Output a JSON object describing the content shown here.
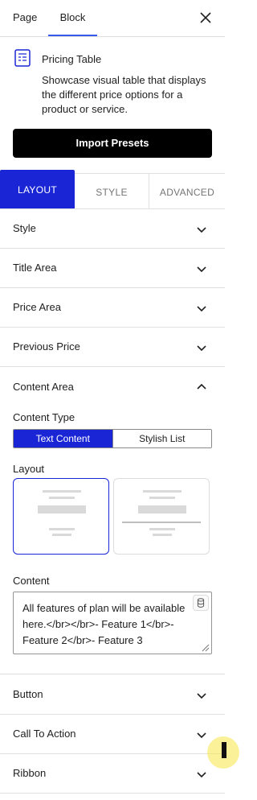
{
  "tabs": {
    "page": "Page",
    "block": "Block"
  },
  "block": {
    "title": "Pricing Table",
    "description": "Showcase visual table that displays the different price options for a product or service.",
    "icon": "pricing-table-icon"
  },
  "import_presets": "Import Presets",
  "panel_tabs": {
    "layout": "LAYOUT",
    "style": "STYLE",
    "advanced": "ADVANCED"
  },
  "sections": {
    "style": "Style",
    "title_area": "Title Area",
    "price_area": "Price Area",
    "previous_price": "Previous Price",
    "content_area": "Content Area",
    "button": "Button",
    "call_to_action": "Call To Action",
    "ribbon": "Ribbon"
  },
  "content_area": {
    "content_type_label": "Content Type",
    "content_type_options": [
      "Text Content",
      "Stylish List"
    ],
    "content_type_selected": "Text Content",
    "layout_label": "Layout",
    "content_label": "Content",
    "content_value": "All features of plan will be available here.</br></br>- Feature 1</br>- Feature 2</br>- Feature 3"
  },
  "colors": {
    "accent": "#1a26d6",
    "tab_underline": "#3858e9",
    "button_bg": "#000000"
  }
}
